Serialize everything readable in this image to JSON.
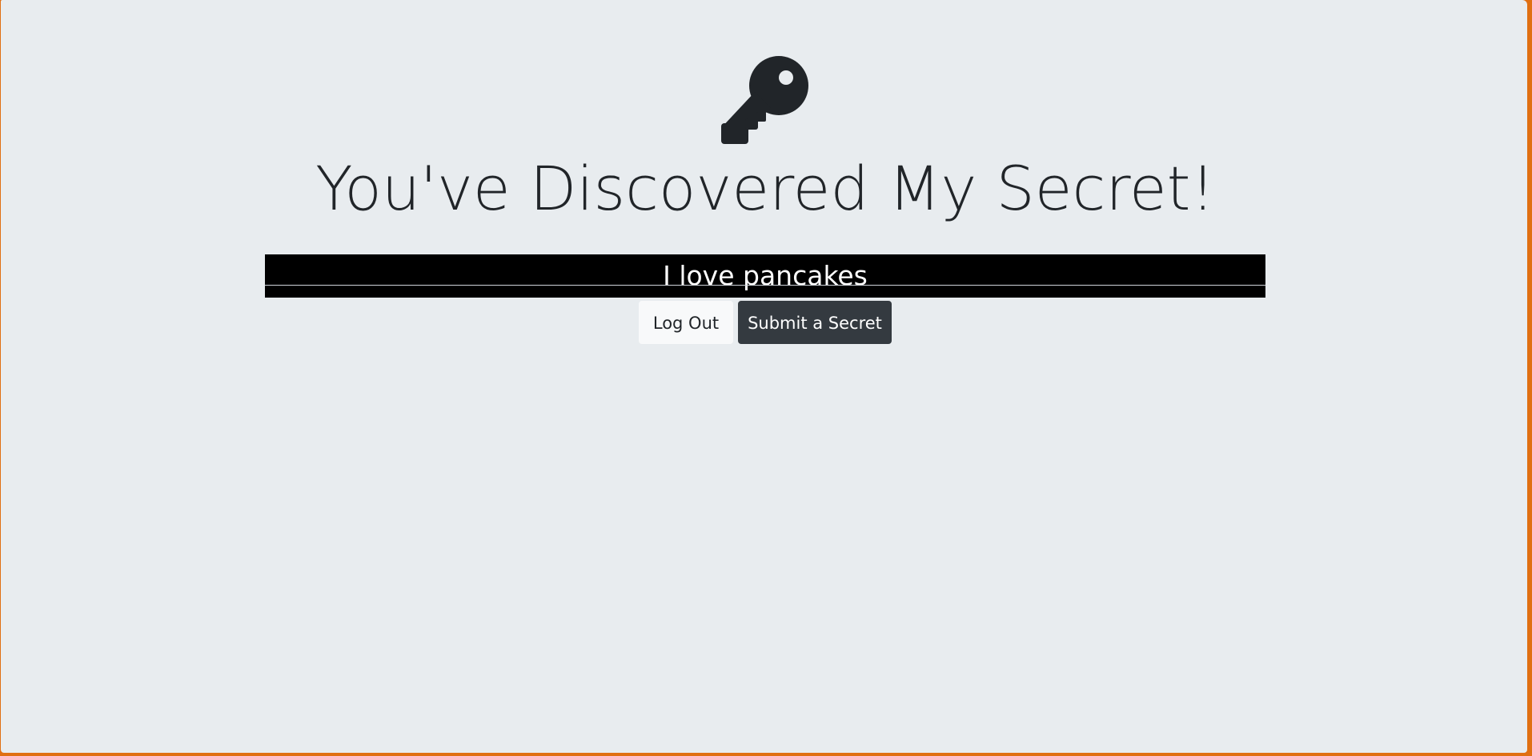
{
  "icon": {
    "name": "key-icon",
    "color": "#212529"
  },
  "title": "You've Discovered My Secret!",
  "secret": {
    "text": "I love pancakes",
    "background": "#000000",
    "color": "#ffffff"
  },
  "buttons": {
    "logout_label": "Log Out",
    "submit_label": "Submit a Secret"
  },
  "colors": {
    "page_background": "#e8ecef",
    "frame_accent": "#e06f12",
    "light_button": "#f8f9fa",
    "dark_button": "#343a40"
  }
}
